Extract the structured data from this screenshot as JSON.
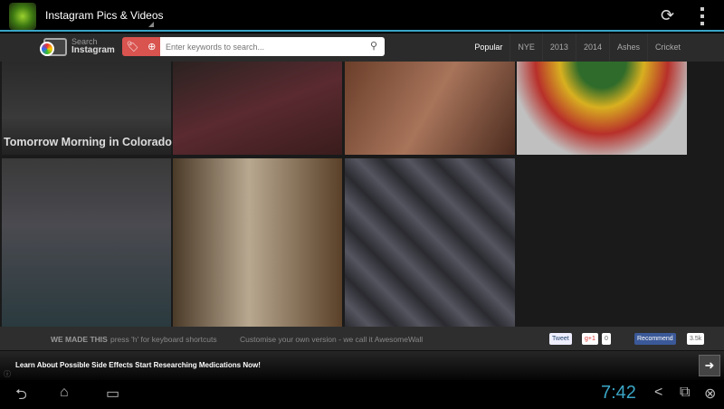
{
  "app": {
    "title": "Instagram Pics & Videos",
    "icon": "cannabis-leaf-app-icon"
  },
  "actions": {
    "refresh_icon": "refresh-icon",
    "overflow_icon": "overflow-menu-icon"
  },
  "search": {
    "brand_line1": "Search",
    "brand_line2": "Instagram",
    "placeholder": "Enter keywords to search..."
  },
  "tabs": [
    "Popular",
    "NYE",
    "2013",
    "2014",
    "Ashes",
    "Cricket"
  ],
  "photos": [
    {
      "caption": "Tomorrow Morning in Colorado"
    },
    {},
    {},
    {},
    {},
    {},
    {}
  ],
  "footer": {
    "we_made_this": "WE MADE THIS",
    "shortcuts": "press 'h' for keyboard shortcuts",
    "customise": "Customise your own version - we call it AwesomeWall",
    "tweet": "Tweet",
    "gplus": "g+1",
    "gplus_count": "0",
    "recommend": "Recommend",
    "recommend_count": "3.5k"
  },
  "ad": {
    "text": "Learn About Possible Side Effects Start Researching Medications Now!"
  },
  "system": {
    "clock": "7:42"
  },
  "colors": {
    "accent": "#3aa6c7",
    "search_red": "#d9534f",
    "facebook": "#3b5998"
  }
}
